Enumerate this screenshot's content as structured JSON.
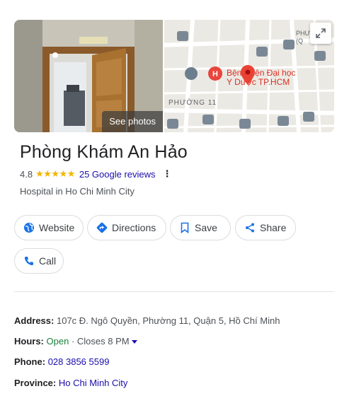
{
  "media": {
    "see_photos_label": "See photos",
    "map": {
      "labels": {
        "hospital_line1": "Bệnh viện Đại học",
        "hospital_line2": "Y Dược TP.HCM",
        "ward": "PHƯỜNG 11",
        "corner_line1": "PHƯ",
        "corner_line2": "(Q"
      },
      "hospital_icon_letter": "H",
      "pin_color": "#ea4335"
    }
  },
  "place": {
    "name": "Phòng Khám An Hảo",
    "rating": "4.8",
    "stars": "★★★★★",
    "reviews_label": "25 Google reviews",
    "more_icon": "⋮",
    "category": "Hospital in Ho Chi Minh City"
  },
  "actions": {
    "website": "Website",
    "directions": "Directions",
    "save": "Save",
    "share": "Share",
    "call": "Call"
  },
  "info": {
    "address_label": "Address:",
    "address_value": "107c Đ. Ngô Quyền, Phường 11, Quận 5, Hồ Chí Minh",
    "hours_label": "Hours:",
    "hours_open": "Open",
    "hours_close": "· Closes 8 PM",
    "phone_label": "Phone:",
    "phone_value": "028 3856 5599",
    "province_label": "Province:",
    "province_value": "Ho Chi Minh City"
  },
  "colors": {
    "link": "#1a0dab",
    "open": "#188038",
    "star": "#f4b400",
    "brand_blue": "#1a73e8"
  }
}
